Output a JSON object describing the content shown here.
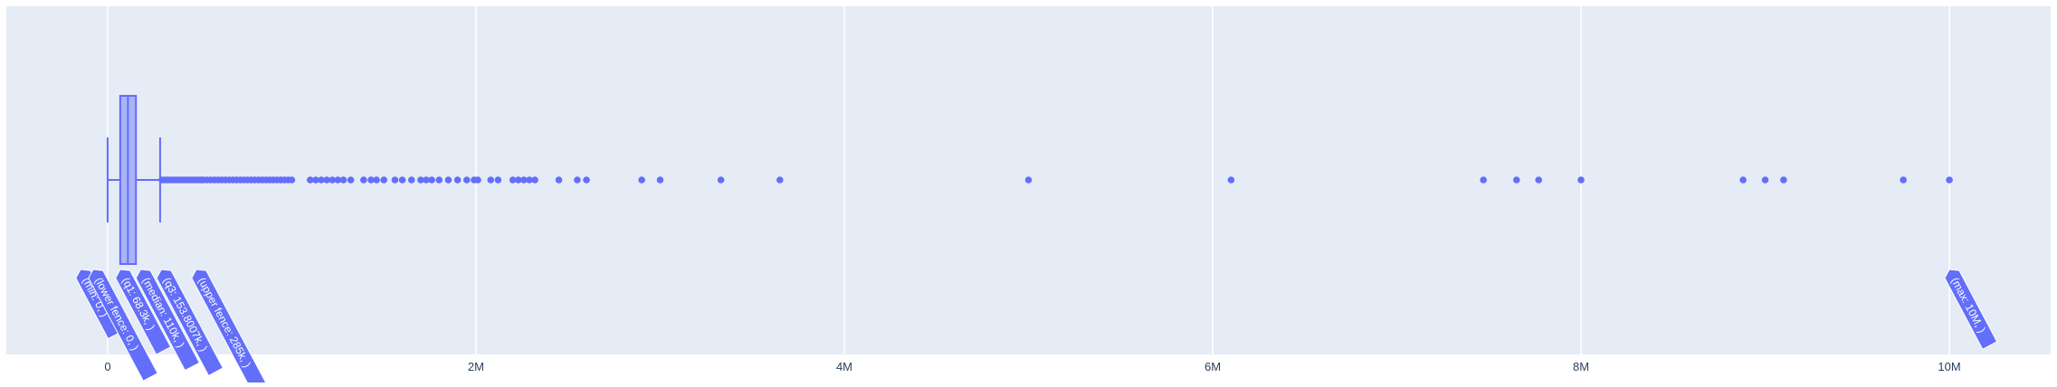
{
  "chart_data": {
    "type": "box",
    "orientation": "horizontal",
    "title": "",
    "xlabel": "",
    "ylabel": "",
    "xlim": [
      -550000,
      10550000
    ],
    "x_tick_values": [
      0,
      2000000,
      4000000,
      6000000,
      8000000,
      10000000
    ],
    "x_tick_labels": [
      "0",
      "2M",
      "4M",
      "6M",
      "8M",
      "10M"
    ],
    "grid": true,
    "colors": {
      "plot_bg": "#e5ecf6",
      "grid": "#ffffff",
      "box_fill": "#abb2f7",
      "box_line": "#636efa",
      "label_bg": "#636efa",
      "label_text": "#ffffff"
    },
    "series": [
      {
        "min": 0,
        "lower_fence": 0,
        "q1": 68300,
        "median": 110000,
        "q3": 153800,
        "upper_fence": 285000,
        "max": 10000000,
        "outliers": [
          295000,
          310000,
          325000,
          340000,
          355000,
          370000,
          385000,
          400000,
          415000,
          430000,
          445000,
          460000,
          475000,
          490000,
          505000,
          520000,
          540000,
          560000,
          580000,
          600000,
          620000,
          640000,
          660000,
          680000,
          700000,
          720000,
          740000,
          760000,
          780000,
          800000,
          820000,
          840000,
          860000,
          880000,
          900000,
          920000,
          940000,
          960000,
          980000,
          1000000,
          1100000,
          1130000,
          1160000,
          1190000,
          1220000,
          1250000,
          1280000,
          1320000,
          1390000,
          1430000,
          1460000,
          1500000,
          1560000,
          1600000,
          1650000,
          1700000,
          1730000,
          1760000,
          1800000,
          1850000,
          1900000,
          1950000,
          1990000,
          2010000,
          2080000,
          2120000,
          2200000,
          2230000,
          2260000,
          2290000,
          2320000,
          2450000,
          2550000,
          2600000,
          2900000,
          3000000,
          3330000,
          3650000,
          5000000,
          6100000,
          7470000,
          7650000,
          7770000,
          8000000,
          8880000,
          9000000,
          9100000,
          9750000,
          10000000
        ]
      }
    ],
    "labels": [
      {
        "text": "(min: 0, )",
        "value": 0
      },
      {
        "text": "(lower fence: 0, )",
        "value": 0
      },
      {
        "text": "(q1: 68.3k, )",
        "value": 68300
      },
      {
        "text": "(median: 110k, )",
        "value": 110000
      },
      {
        "text": "(q3: 153.8007k, )",
        "value": 153800
      },
      {
        "text": "(upper fence: 285k, )",
        "value": 285000
      },
      {
        "text": "(max: 10M, )",
        "value": 10000000
      }
    ]
  }
}
